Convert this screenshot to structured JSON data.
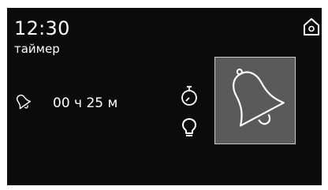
{
  "status": {
    "time": "12:30",
    "mode_label": "таймер"
  },
  "timer": {
    "value": "00 ч 25 м"
  },
  "icons": {
    "home": "home-icon",
    "bell_small": "bell-icon",
    "stopwatch": "stopwatch-icon",
    "bulb": "light-bulb-icon",
    "bell_large": "bell-icon"
  },
  "colors": {
    "background": "#0b0b0b",
    "foreground": "#ffffff",
    "tile": "#5a5a5a"
  }
}
